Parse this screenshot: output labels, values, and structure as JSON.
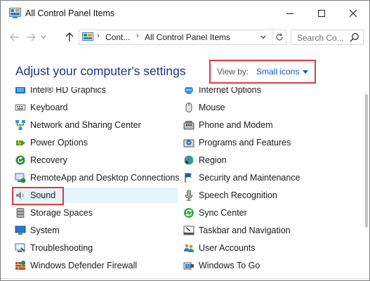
{
  "window": {
    "title": "All Control Panel Items"
  },
  "address_bar": {
    "crumbs": [
      "Cont...",
      "All Control Panel Items"
    ],
    "search_placeholder": "Search Co..."
  },
  "header": {
    "title": "Adjust your computer's settings",
    "view_by_label": "View by:",
    "view_by_value": "Small icons"
  },
  "items_left": [
    {
      "label": "Intel® HD Graphics",
      "icon": "graphics-icon"
    },
    {
      "label": "Keyboard",
      "icon": "keyboard-icon"
    },
    {
      "label": "Network and Sharing Center",
      "icon": "network-icon"
    },
    {
      "label": "Power Options",
      "icon": "power-icon"
    },
    {
      "label": "Recovery",
      "icon": "recovery-icon"
    },
    {
      "label": "RemoteApp and Desktop Connections",
      "icon": "remoteapp-icon"
    },
    {
      "label": "Sound",
      "icon": "sound-icon"
    },
    {
      "label": "Storage Spaces",
      "icon": "storage-icon"
    },
    {
      "label": "System",
      "icon": "system-icon"
    },
    {
      "label": "Troubleshooting",
      "icon": "troubleshooting-icon"
    },
    {
      "label": "Windows Defender Firewall",
      "icon": "firewall-icon"
    }
  ],
  "items_right": [
    {
      "label": "Internet Options",
      "icon": "internet-options-icon"
    },
    {
      "label": "Mouse",
      "icon": "mouse-icon"
    },
    {
      "label": "Phone and Modem",
      "icon": "phone-icon"
    },
    {
      "label": "Programs and Features",
      "icon": "programs-icon"
    },
    {
      "label": "Region",
      "icon": "region-icon"
    },
    {
      "label": "Security and Maintenance",
      "icon": "security-flag-icon"
    },
    {
      "label": "Speech Recognition",
      "icon": "microphone-icon"
    },
    {
      "label": "Sync Center",
      "icon": "sync-icon"
    },
    {
      "label": "Taskbar and Navigation",
      "icon": "taskbar-icon"
    },
    {
      "label": "User Accounts",
      "icon": "users-icon"
    },
    {
      "label": "Windows To Go",
      "icon": "windows-to-go-icon"
    }
  ],
  "colors": {
    "heading": "#1e3287",
    "link": "#0b5cd5",
    "highlight_box": "#e03a3e",
    "selected_row": "#e5f3fb"
  }
}
